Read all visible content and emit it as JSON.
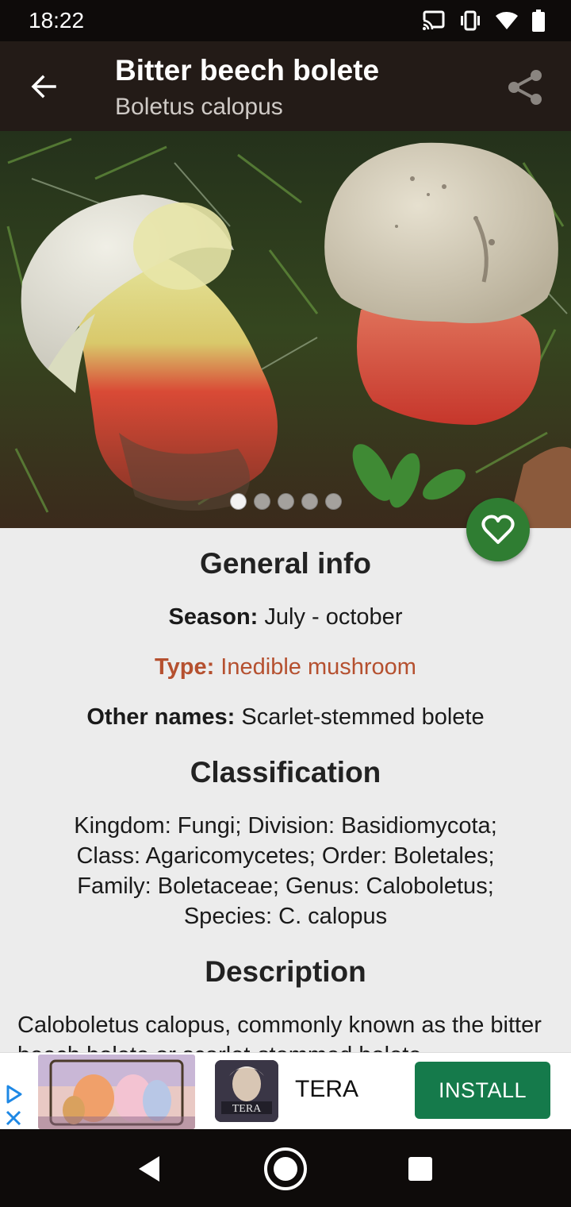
{
  "status_bar": {
    "time": "18:22",
    "icons": [
      "cast-icon",
      "vibrate-icon",
      "wifi-icon",
      "battery-icon"
    ]
  },
  "app_bar": {
    "title": "Bitter beech bolete",
    "subtitle": "Boletus calopus",
    "back_icon": "arrow-back-icon",
    "share_icon": "share-icon"
  },
  "gallery": {
    "image_count": 5,
    "active_index": 0
  },
  "favorite_icon": "heart-outline-icon",
  "general_info": {
    "heading": "General info",
    "season_label": "Season:",
    "season_value": " July - october",
    "type_label": "Type:",
    "type_value": " Inedible mushroom",
    "other_names_label": "Other names:",
    "other_names_value": " Scarlet-stemmed bolete"
  },
  "classification": {
    "heading": "Classification",
    "lines": [
      "Kingdom: Fungi; Division: Basidiomycota;",
      "Class: Agaricomycetes; Order: Boletales;",
      "Family: Boletaceae; Genus: Caloboletus;",
      "Species: C. calopus"
    ]
  },
  "description": {
    "heading": "Description",
    "text": "Caloboletus calopus, commonly known as the bitter beech bolete or scarlet-stemmed bolete"
  },
  "ad": {
    "app_name": "TERA",
    "install_label": "INSTALL",
    "icon_text": "TERA"
  },
  "colors": {
    "app_bar": "#231b17",
    "type_text": "#b5502f",
    "fab": "#2f7d32",
    "install_button": "#157a4b"
  }
}
